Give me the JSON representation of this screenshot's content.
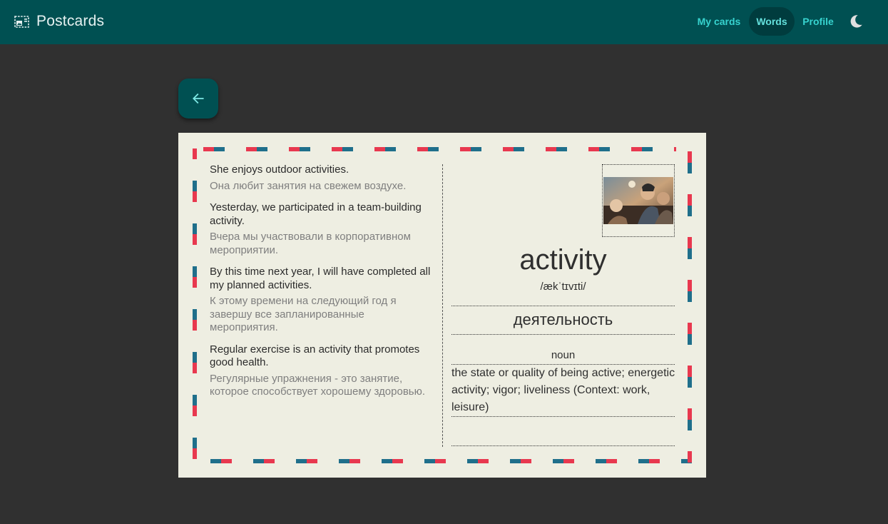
{
  "header": {
    "title": "Postcards",
    "brand_icon": "postcard-icon",
    "nav": [
      {
        "label": "My cards",
        "active": false
      },
      {
        "label": "Words",
        "active": true
      },
      {
        "label": "Profile",
        "active": false
      }
    ],
    "theme_icon": "moon-icon",
    "colors": {
      "bar": "#005052",
      "accent": "#37d3cf"
    }
  },
  "back_button": {
    "icon": "arrow-left-icon"
  },
  "card": {
    "examples": [
      {
        "en": "She enjoys outdoor activities.",
        "ru": "Она любит занятия на свежем воздухе."
      },
      {
        "en": "Yesterday, we participated in a team-building activity.",
        "ru": "Вчера мы участвовали в корпоративном мероприятии."
      },
      {
        "en": "By this time next year, I will have completed all my planned activities.",
        "ru": "К этому времени на следующий год я завершу все запланированные мероприятия."
      },
      {
        "en": "Regular exercise is an activity that promotes good health.",
        "ru": "Регулярные упражнения - это занятие, которое способствует хорошему здоровью."
      }
    ],
    "word": "activity",
    "transcription": "/ækˈtɪvɪti/",
    "translation": "деятельность",
    "part_of_speech": "noun",
    "definition": "the state or quality of being active; energetic activity; vigor; liveliness (Context: work, leisure)",
    "stripe_colors": {
      "red": "#e8384f",
      "blue": "#1f6f8b"
    }
  }
}
